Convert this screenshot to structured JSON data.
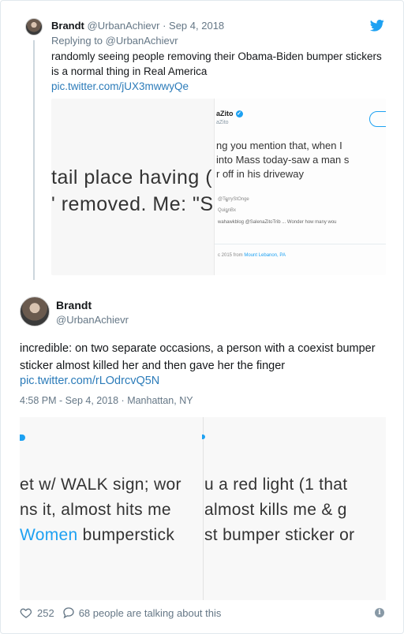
{
  "reply_tweet": {
    "name": "Brandt",
    "handle": "@UrbanAchievr",
    "separator": " · ",
    "date": "Sep 4, 2018",
    "replying_to": "Replying to @UrbanAchievr",
    "text": "randomly seeing people removing their Obama-Biden bumper stickers is a normal thing in Real America",
    "link": "pic.twitter.com/jUX3mwwyQe",
    "media": {
      "left_line1": "tail place having (",
      "left_line2": "' removed. Me: \"S(",
      "author_name": "aZito",
      "author_handle": "aZito",
      "text_line1": "ng you mention that, when I",
      "text_line2": "into Mass today-saw a man s",
      "text_line3": "r off in his driveway",
      "small_line1": "@TerryStOnge",
      "small_line2": "QuinnBx",
      "small_line3": "wahawkblog @SalenaZitoTrib ... Wonder how many wou",
      "footer_prefix": "c 2015 from ",
      "footer_location": "Mount Lebanon, PA"
    }
  },
  "main_tweet": {
    "name": "Brandt",
    "handle": "@UrbanAchievr",
    "text": "incredible: on two separate occasions, a person with a coexist bumper sticker almost killed her and then gave her the finger",
    "link": "pic.twitter.com/rLOdrcvQ5N",
    "meta": "4:58 PM - Sep 4, 2018 · Manhattan, NY",
    "media": {
      "left_line1": "et w/ WALK sign; wor",
      "left_line2": "ns it, almost hits me",
      "left_line3_blue": "Women",
      "left_line3_rest": " bumperstick",
      "right_line1": "u a red light (1 that",
      "right_line2": "almost kills me & g",
      "right_line3": "st bumper sticker or"
    }
  },
  "footer": {
    "likes": "252",
    "conversation": "68 people are talking about this"
  },
  "colors": {
    "link": "#2b7bb9",
    "twitter_blue": "#1da1f2",
    "secondary_text": "#657786"
  }
}
